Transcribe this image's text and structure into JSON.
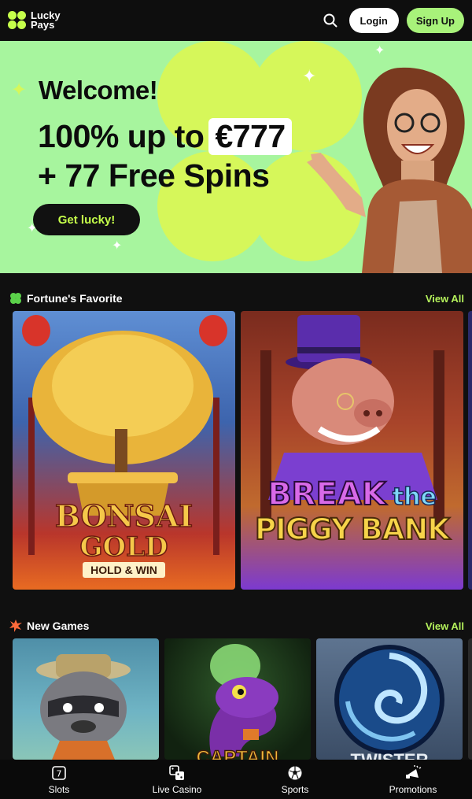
{
  "header": {
    "logo_line1": "Lucky",
    "logo_line2": "Pays",
    "login_label": "Login",
    "signup_label": "Sign Up",
    "colors": {
      "signup": "#a8f27a",
      "logo": "#c5ff4a"
    }
  },
  "hero": {
    "welcome": "Welcome!",
    "line1_prefix": "100% up to",
    "line1_amount": "€777",
    "line2": "+ 77 Free Spins",
    "cta_label": "Get lucky!",
    "colors": {
      "background": "#a7f59e",
      "clover": "#d6f75a",
      "cta_text": "#c5ff4a"
    }
  },
  "sections": {
    "favorites": {
      "title": "Fortune's Favorite",
      "icon": "clover-icon",
      "view_all": "View All",
      "games": [
        {
          "line1": "BONSAI",
          "line2": "GOLD",
          "line3": "HOLD & WIN"
        },
        {
          "line1": "BREAK",
          "line1b": "the",
          "line2": "PIGGY BANK"
        }
      ]
    },
    "new_games": {
      "title": "New Games",
      "icon": "burst-icon",
      "view_all": "View All",
      "games": [
        {
          "line1": ""
        },
        {
          "line1": "CAPTAIN"
        },
        {
          "line1": "TWISTER"
        }
      ]
    }
  },
  "bottom_nav": [
    {
      "label": "Slots",
      "icon": "slot-machine-icon"
    },
    {
      "label": "Live Casino",
      "icon": "dice-icon"
    },
    {
      "label": "Sports",
      "icon": "soccer-ball-icon"
    },
    {
      "label": "Promotions",
      "icon": "megaphone-icon"
    }
  ]
}
